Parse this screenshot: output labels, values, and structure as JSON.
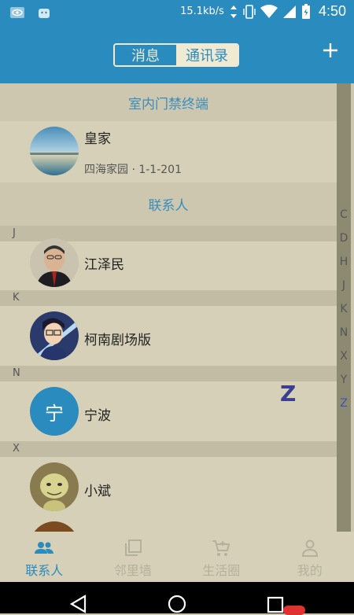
{
  "status_bar": {
    "net_speed": "15.1kb/s",
    "time": "4:50"
  },
  "header": {
    "tabs": [
      {
        "label": "消息",
        "active": false
      },
      {
        "label": "通讯录",
        "active": true
      }
    ],
    "add_icon": "plus-icon"
  },
  "contacts": {
    "section_terminal": "室内门禁终端",
    "terminal": {
      "name": "皇家",
      "address": "四海家园 · 1-1-201"
    },
    "section_people": "联系人",
    "groups": [
      {
        "letter": "J",
        "name": "江泽民"
      },
      {
        "letter": "K",
        "name": "柯南剧场版"
      },
      {
        "letter": "N",
        "name": "宁波",
        "avatar_text": "宁"
      },
      {
        "letter": "X",
        "name": "小斌"
      }
    ]
  },
  "index_bar": [
    "C",
    "D",
    "H",
    "J",
    "K",
    "N",
    "X",
    "Y",
    "Z"
  ],
  "index_highlight": "Z",
  "index_overlay": "Z",
  "bottom_nav": [
    {
      "label": "联系人",
      "icon": "people-icon",
      "active": true
    },
    {
      "label": "邻里墙",
      "icon": "wall-icon",
      "active": false
    },
    {
      "label": "生活圈",
      "icon": "cart-icon",
      "active": false
    },
    {
      "label": "我的",
      "icon": "person-icon",
      "active": false
    }
  ],
  "colors": {
    "accent": "#2a8bbe",
    "background": "#cdc7b0",
    "inactive": "#b5b09c"
  }
}
